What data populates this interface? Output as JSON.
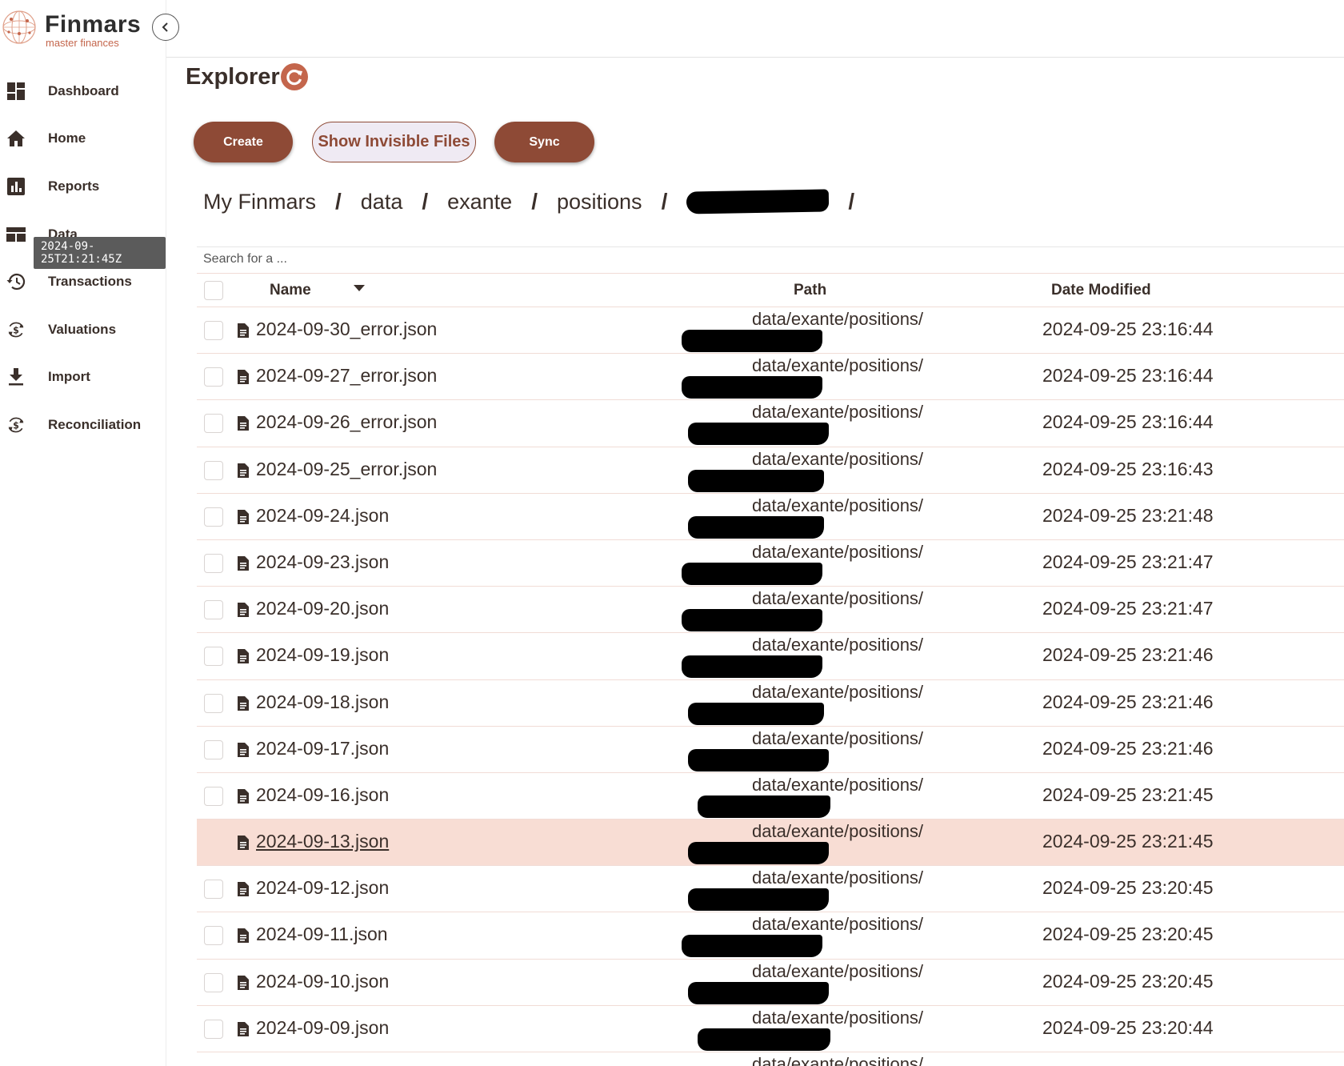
{
  "app": {
    "name": "Finmars",
    "tagline": "master finances"
  },
  "sidebar": {
    "items": [
      {
        "label": "Dashboard",
        "icon": "dashboard-icon"
      },
      {
        "label": "Home",
        "icon": "home-icon"
      },
      {
        "label": "Reports",
        "icon": "bar-chart-icon"
      },
      {
        "label": "Data",
        "icon": "table-icon"
      },
      {
        "label": "Transactions",
        "icon": "history-icon"
      },
      {
        "label": "Valuations",
        "icon": "currency-sync-icon"
      },
      {
        "label": "Import",
        "icon": "download-icon"
      },
      {
        "label": "Reconciliation",
        "icon": "currency-sync-icon"
      }
    ],
    "tooltip": "2024-09-25T21:21:45Z"
  },
  "page": {
    "title": "Explorer"
  },
  "toolbar": {
    "create_label": "Create",
    "show_invisible_label": "Show Invisible Files",
    "sync_label": "Sync"
  },
  "breadcrumb": {
    "items": [
      "My Finmars",
      "data",
      "exante",
      "positions"
    ],
    "separator": "/"
  },
  "search": {
    "placeholder": "Search for a ..."
  },
  "table": {
    "headers": {
      "name": "Name",
      "path": "Path",
      "date": "Date Modified"
    },
    "rows": [
      {
        "name": "2024-09-30_error.json",
        "path": "data/exante/positions/",
        "date": "2024-09-25 23:16:44"
      },
      {
        "name": "2024-09-27_error.json",
        "path": "data/exante/positions/",
        "date": "2024-09-25 23:16:44"
      },
      {
        "name": "2024-09-26_error.json",
        "path": "data/exante/positions/",
        "date": "2024-09-25 23:16:44"
      },
      {
        "name": "2024-09-25_error.json",
        "path": "data/exante/positions/",
        "date": "2024-09-25 23:16:43"
      },
      {
        "name": "2024-09-24.json",
        "path": "data/exante/positions/",
        "date": "2024-09-25 23:21:48"
      },
      {
        "name": "2024-09-23.json",
        "path": "data/exante/positions/",
        "date": "2024-09-25 23:21:47"
      },
      {
        "name": "2024-09-20.json",
        "path": "data/exante/positions/",
        "date": "2024-09-25 23:21:47"
      },
      {
        "name": "2024-09-19.json",
        "path": "data/exante/positions/",
        "date": "2024-09-25 23:21:46"
      },
      {
        "name": "2024-09-18.json",
        "path": "data/exante/positions/",
        "date": "2024-09-25 23:21:46"
      },
      {
        "name": "2024-09-17.json",
        "path": "data/exante/positions/",
        "date": "2024-09-25 23:21:46"
      },
      {
        "name": "2024-09-16.json",
        "path": "data/exante/positions/",
        "date": "2024-09-25 23:21:45"
      },
      {
        "name": "2024-09-13.json",
        "path": "data/exante/positions/",
        "date": "2024-09-25 23:21:45",
        "highlighted": true
      },
      {
        "name": "2024-09-12.json",
        "path": "data/exante/positions/",
        "date": "2024-09-25 23:20:45"
      },
      {
        "name": "2024-09-11.json",
        "path": "data/exante/positions/",
        "date": "2024-09-25 23:20:45"
      },
      {
        "name": "2024-09-10.json",
        "path": "data/exante/positions/",
        "date": "2024-09-25 23:20:45"
      },
      {
        "name": "2024-09-09.json",
        "path": "data/exante/positions/",
        "date": "2024-09-25 23:20:44"
      },
      {
        "name": "",
        "path": "data/exante/positions/",
        "date": ""
      }
    ]
  },
  "colors": {
    "accent": "#8e4a36",
    "row_highlight": "#f8ddd4",
    "logo_orange": "#c4664c"
  }
}
